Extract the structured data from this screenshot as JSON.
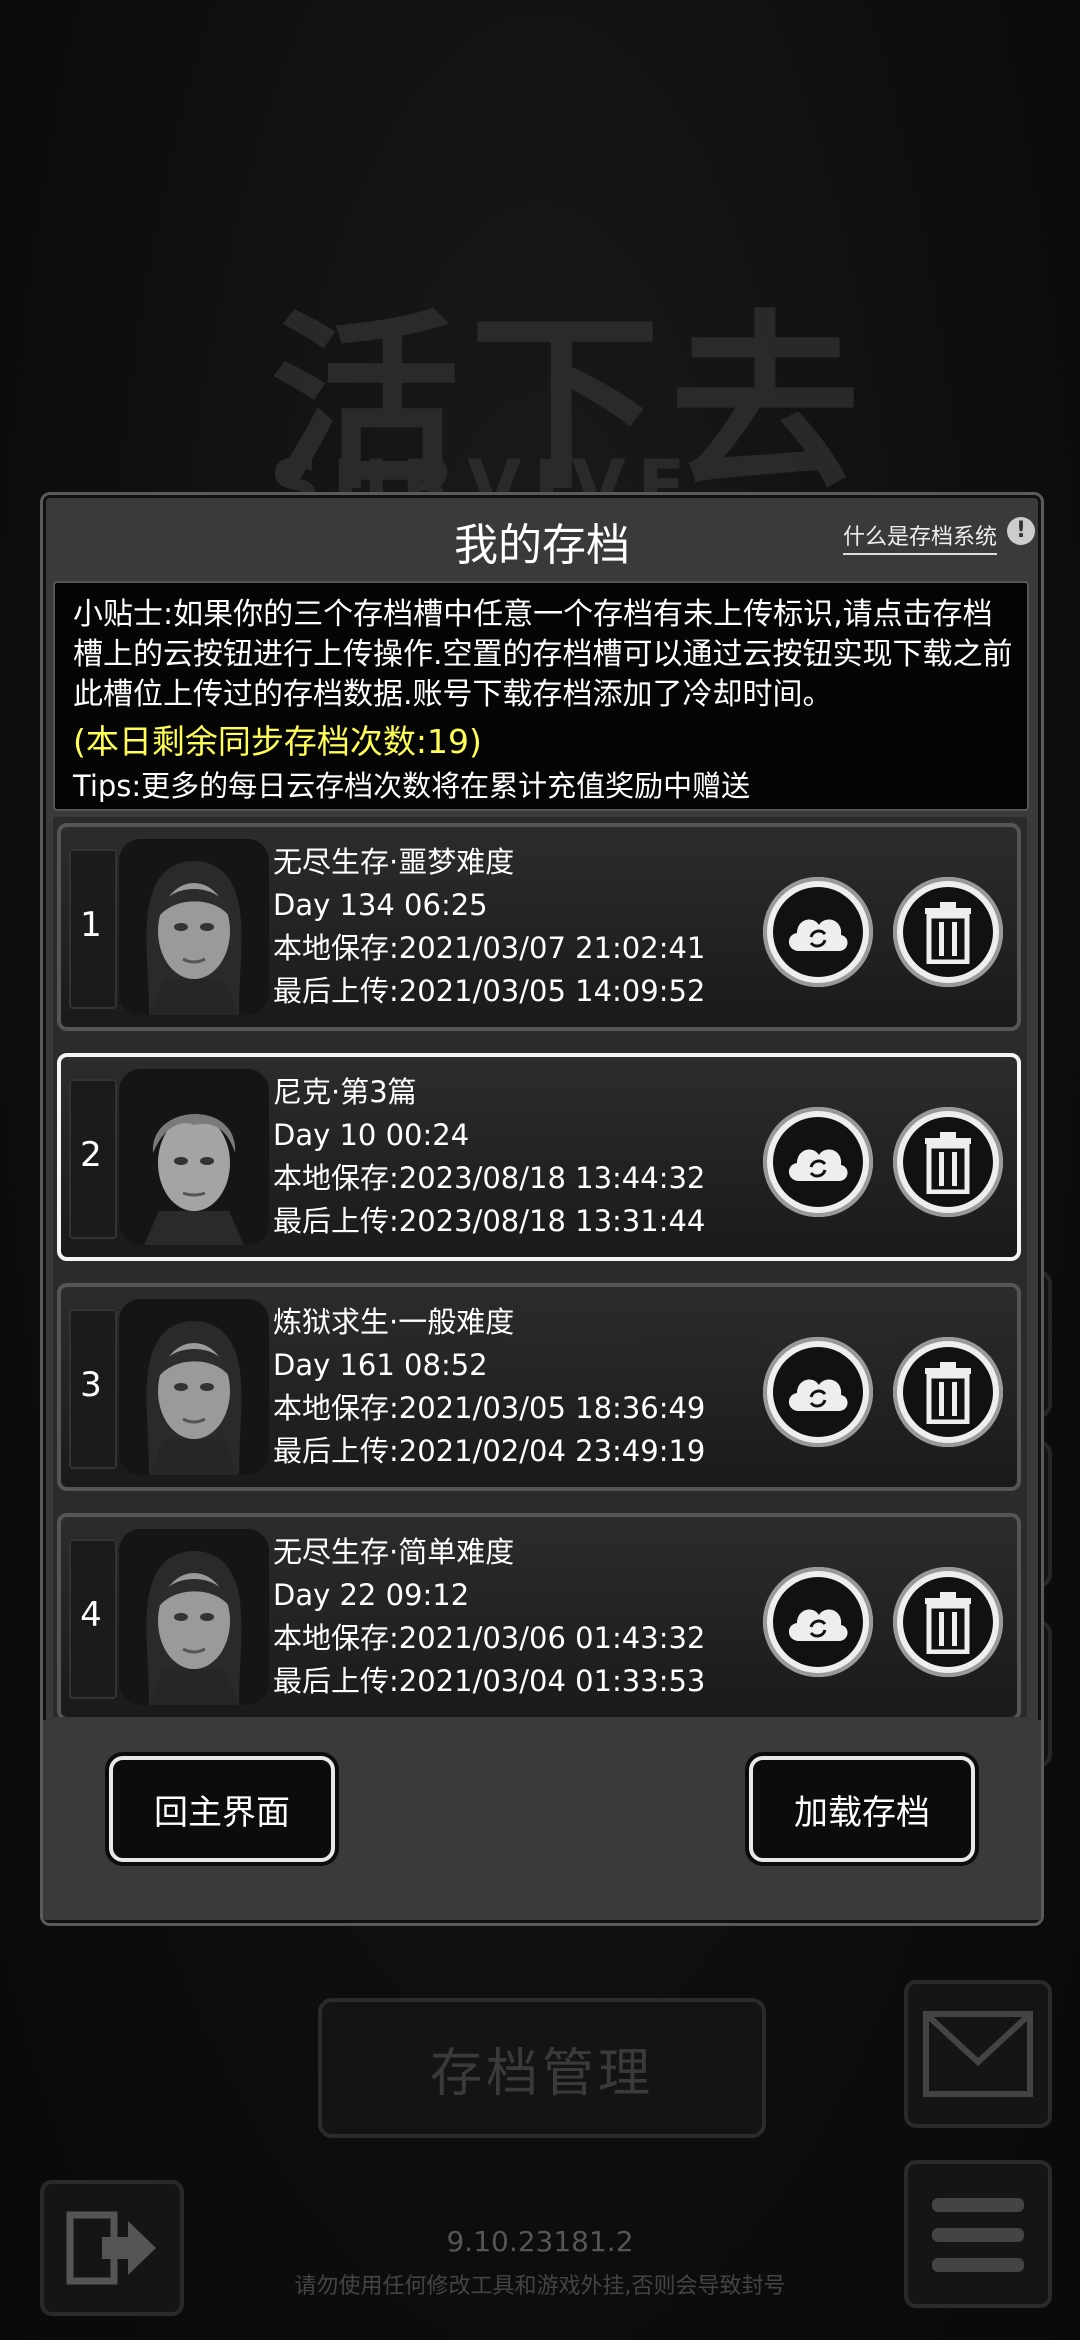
{
  "background": {
    "game_title": "活下去",
    "game_subtitle": "SURVIVE",
    "manage_label": "存档管理",
    "version": "9.10.23181.2",
    "warning": "请勿使用任何修改工具和游戏外挂,否则会导致封号"
  },
  "dialog": {
    "title": "我的存档",
    "help_link": "什么是存档系统",
    "help_icon": "!",
    "tips": {
      "text": "小贴士:如果你的三个存档槽中任意一个存档有未上传标识,请点击存档槽上的云按钮进行上传操作.空置的存档槽可以通过云按钮实现下载之前此槽位上传过的存档数据.账号下载存档添加了冷却时间。",
      "sync_count": "(本日剩余同步存档次数:19)",
      "extra": "Tips:更多的每日云存档次数将在累计充值奖励中赠送"
    },
    "slots": [
      {
        "number": "1",
        "mode": "无尽生存·噩梦难度",
        "day": "Day 134  06:25",
        "local_save": "本地保存:2021/03/07  21:02:41",
        "last_upload": "最后上传:2021/03/05  14:09:52",
        "portrait": "female-survivor"
      },
      {
        "number": "2",
        "mode": "尼克·第3篇",
        "day": "Day 10  00:24",
        "local_save": "本地保存:2023/08/18  13:44:32",
        "last_upload": "最后上传:2023/08/18  13:31:44",
        "portrait": "male-survivor"
      },
      {
        "number": "3",
        "mode": "炼狱求生·一般难度",
        "day": "Day 161  08:52",
        "local_save": "本地保存:2021/03/05  18:36:49",
        "last_upload": "最后上传:2021/02/04  23:49:19",
        "portrait": "female-survivor"
      },
      {
        "number": "4",
        "mode": "无尽生存·简单难度",
        "day": "Day 22  09:12",
        "local_save": "本地保存:2021/03/06  01:43:32",
        "last_upload": "最后上传:2021/03/04  01:33:53",
        "portrait": "female-survivor"
      }
    ],
    "home_label": "回主界面",
    "load_label": "加载存档"
  },
  "colors": {
    "tip_highlight": "#ffff55",
    "panel": "#3a3a3a",
    "selected_border": "#f5f5f5"
  }
}
